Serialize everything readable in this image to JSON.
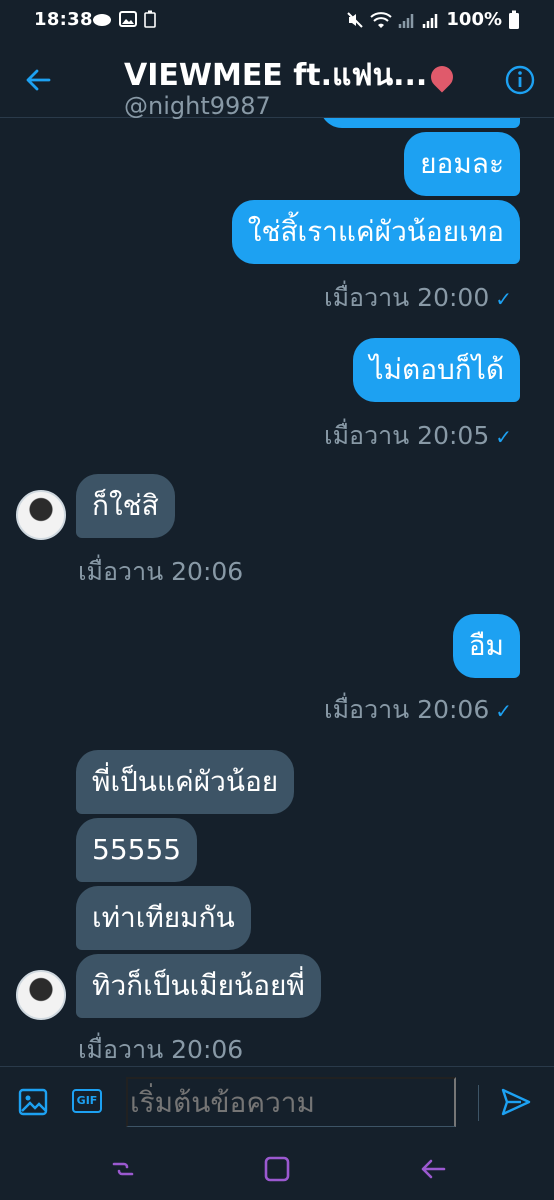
{
  "status_bar": {
    "time": "18:38",
    "battery": "100%"
  },
  "header": {
    "title": "VIEWMEE ft.แฟน...",
    "handle": "@night9987"
  },
  "messages": [
    {
      "text": "ยอมละ",
      "dir": "out"
    },
    {
      "text": "ใช่สิ้เราแค่ผัวน้อยเทอ",
      "dir": "out"
    },
    {
      "time": "เมื่อวาน 20:00",
      "dir": "out"
    },
    {
      "text": "ไม่ตอบก็ได้",
      "dir": "out"
    },
    {
      "time": "เมื่อวาน 20:05",
      "dir": "out"
    },
    {
      "text": "ก็ใช่สิ",
      "dir": "in"
    },
    {
      "time": "เมื่อวาน 20:06",
      "dir": "in"
    },
    {
      "text": "อืม",
      "dir": "out"
    },
    {
      "time": "เมื่อวาน 20:06",
      "dir": "out"
    },
    {
      "text": "พี่เป็นแค่ผัวน้อย",
      "dir": "in"
    },
    {
      "text": "55555",
      "dir": "in"
    },
    {
      "text": "เท่าเทียมกัน",
      "dir": "in"
    },
    {
      "text": "ทิวก็เป็นเมียน้อยพี่",
      "dir": "in"
    },
    {
      "time": "เมื่อวาน 20:06",
      "dir": "in"
    }
  ],
  "composer": {
    "placeholder": "เริ่มต้นข้อความ",
    "gif_label": "GIF"
  },
  "colors": {
    "background": "#15202b",
    "outgoing_bubble": "#1da1f2",
    "incoming_bubble": "#3d5466",
    "accent": "#1da1f2",
    "meta_text": "#8899a6",
    "nav_icons": "#9b59d0"
  },
  "icons": [
    "arrow-back-icon",
    "info-icon",
    "image-icon",
    "gif-icon",
    "send-icon",
    "recent-apps-icon",
    "home-icon",
    "back-icon"
  ]
}
